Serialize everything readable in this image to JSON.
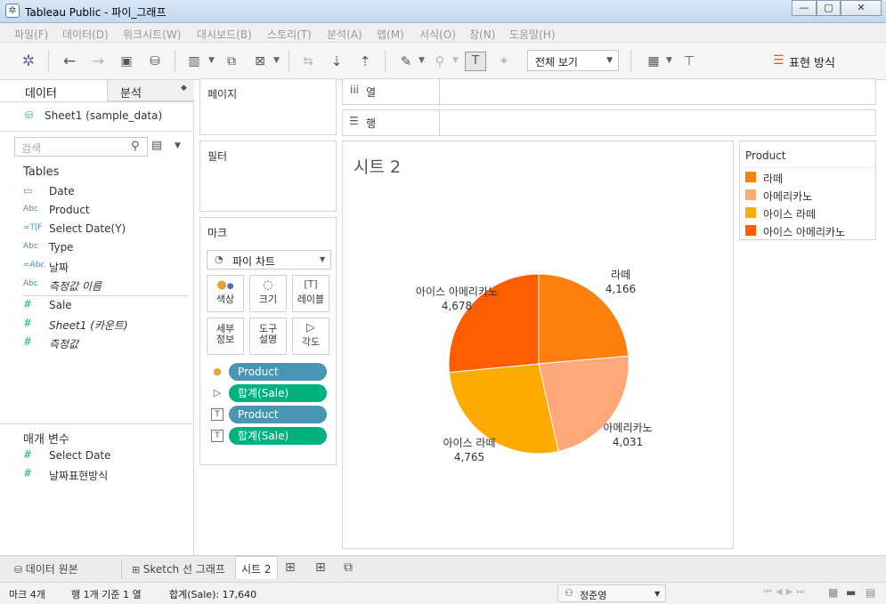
{
  "window": {
    "title": "Tableau Public - 파이_그래프",
    "controls": {
      "minimize": "—",
      "maximize": "▢",
      "close": "✕"
    }
  },
  "menu": [
    "파일(F)",
    "데이터(D)",
    "워크시트(W)",
    "대시보드(B)",
    "스토리(T)",
    "분석(A)",
    "맵(M)",
    "서식(O)",
    "창(N)",
    "도움말(H)"
  ],
  "toolbar": {
    "fit_value": "전체 보기",
    "show_me_label": "표현 방식"
  },
  "data_pane": {
    "tab_data": "데이터",
    "tab_analysis": "분석",
    "datasource": "Sheet1 (sample_data)",
    "search_placeholder": "검색",
    "tables_header": "Tables",
    "fields": [
      {
        "icon": "calendar-icon",
        "type_glyph": "📅",
        "label": "Date",
        "italic": false
      },
      {
        "icon": "abc-icon",
        "type_glyph": "Abc",
        "label": "Product",
        "italic": false
      },
      {
        "icon": "param-string-icon",
        "type_glyph": "=T|F",
        "label": "Select Date(Y)",
        "italic": false
      },
      {
        "icon": "abc-icon",
        "type_glyph": "Abc",
        "label": "Type",
        "italic": false
      },
      {
        "icon": "calc-abc-icon",
        "type_glyph": "=Abc",
        "label": "날짜",
        "italic": false
      },
      {
        "icon": "abc-icon",
        "type_glyph": "Abc",
        "label": "측정값 이름",
        "italic": true
      }
    ],
    "measures": [
      {
        "label": "Sale",
        "italic": false
      },
      {
        "label": "Sheet1 (카운트)",
        "italic": true
      },
      {
        "label": "측정값",
        "italic": true
      }
    ],
    "params_header": "매개 변수",
    "params": [
      {
        "label": "Select Date"
      },
      {
        "label": "날짜표현방식"
      }
    ]
  },
  "shelves": {
    "pages": "페이지",
    "filters": "필터",
    "columns": "열",
    "rows": "행"
  },
  "marks": {
    "title": "마크",
    "type": "파이 차트",
    "buttons": [
      {
        "icon": "color-dots-icon",
        "label": "색상"
      },
      {
        "icon": "size-icon",
        "label": "크기"
      },
      {
        "icon": "label-icon",
        "label": "레이블"
      },
      {
        "icon": "detail-icon",
        "label": "세부\n정보"
      },
      {
        "icon": "tooltip-icon",
        "label": "도구\n설명"
      },
      {
        "icon": "angle-icon",
        "label": "각도"
      }
    ],
    "pills": [
      {
        "icon": "color-dots-icon",
        "label": "Product",
        "kind": "dim"
      },
      {
        "icon": "angle-icon",
        "label": "합계(Sale)",
        "kind": "mea"
      },
      {
        "icon": "label-icon",
        "label": "Product",
        "kind": "dim"
      },
      {
        "icon": "label-icon",
        "label": "합계(Sale)",
        "kind": "mea"
      }
    ]
  },
  "view": {
    "sheet_title": "시트 2"
  },
  "legend": {
    "title": "Product",
    "items": [
      {
        "label": "라떼",
        "color": "#ff7f0e"
      },
      {
        "label": "아메리카노",
        "color": "#ffa97a"
      },
      {
        "label": "아이스 라떼",
        "color": "#ffaa00"
      },
      {
        "label": "아이스 아메리카노",
        "color": "#ff5e00"
      }
    ]
  },
  "chart_data": {
    "type": "pie",
    "title": "시트 2",
    "categories": [
      "라떼",
      "아메리카노",
      "아이스 라떼",
      "아이스 아메리카노"
    ],
    "values": [
      4166,
      4031,
      4765,
      4678
    ],
    "value_labels": [
      "4,166",
      "4,031",
      "4,765",
      "4,678"
    ],
    "colors": [
      "#ff7f0e",
      "#ffa97a",
      "#ffaa00",
      "#ff5e00"
    ],
    "legend": "top-right"
  },
  "sheet_tabs": {
    "data_source": "데이터 원본",
    "tabs": [
      "Sketch 선 그래프",
      "시트 2"
    ],
    "active": "시트 2"
  },
  "status": {
    "marks": "마크 4개",
    "rows_cols": "행 1개 기준 1 열",
    "sum": "합계(Sale): 17,640",
    "user": "정준영"
  }
}
